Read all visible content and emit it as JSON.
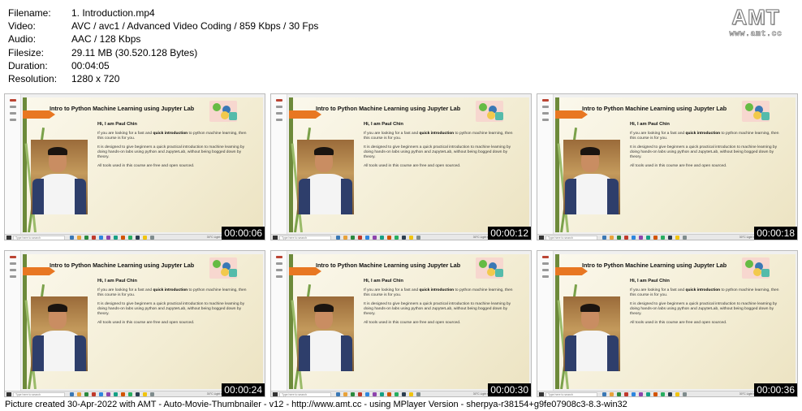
{
  "info": {
    "rows": [
      {
        "key": "Filename:",
        "value": "1. Introduction.mp4"
      },
      {
        "key": "Video:",
        "value": "AVC / avc1 / Advanced Video Coding / 859 Kbps / 30 Fps"
      },
      {
        "key": "Audio:",
        "value": "AAC / 128 Kbps"
      },
      {
        "key": "Filesize:",
        "value": "29.11 MB (30.520.128 Bytes)"
      },
      {
        "key": "Duration:",
        "value": "00:04:05"
      },
      {
        "key": "Resolution:",
        "value": "1280 x 720"
      }
    ]
  },
  "logo": {
    "big": "AMT",
    "small": "www.amt.cc"
  },
  "slide": {
    "title": "Intro to Python Machine Learning using Jupyter Lab",
    "greeting": "Hi, I am Paul Chin",
    "p1_a": "If you are looking for a fast and ",
    "p1_b": "quick introduction",
    "p1_c": " to python machine learning, then this course is for you.",
    "p2": "It is designed to give beginners a quick practical introduction to machine learning by doing hands-on labs using python and JupyterLab, without being bogged down by theory.",
    "p3": "All tools used in this course are free and open sourced.",
    "search_placeholder": "Type here to search",
    "tray": "30°C Light rain"
  },
  "timestamps": [
    "00:00:06",
    "00:00:12",
    "00:00:18",
    "00:00:24",
    "00:00:30",
    "00:00:36"
  ],
  "footer": "Picture created 30-Apr-2022 with AMT - Auto-Movie-Thumbnailer - v12 - http://www.amt.cc - using MPlayer Version - sherpya-r38154+g9fe07908c3-8.3-win32",
  "colors": {
    "arrow": "#e87722",
    "timestamp_bg": "#000000",
    "slide_bg": "#f5efd8"
  }
}
